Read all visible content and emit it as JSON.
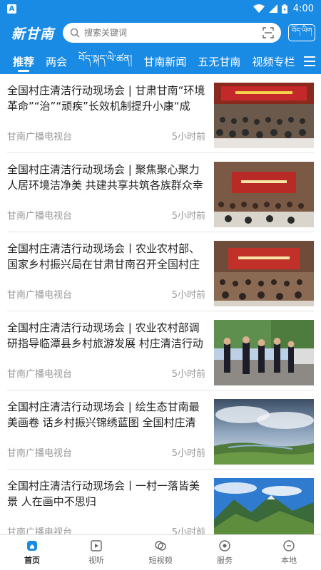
{
  "status_bar": {
    "time": "4:00",
    "app_badge": "A"
  },
  "header": {
    "logo": "新甘南",
    "search_placeholder": "搜索关键词",
    "lang_button": "བོད་ཡིག"
  },
  "tabs": [
    {
      "label": "推荐",
      "active": true
    },
    {
      "label": "两会"
    },
    {
      "label": "བོད་སྐད་ལེ་ཚན།"
    },
    {
      "label": "甘南新闻"
    },
    {
      "label": "五无甘南"
    },
    {
      "label": "视频专栏"
    }
  ],
  "feed": [
    {
      "title": "全国村庄清洁行动现场会 | 甘肃甘南“环境革命”“治”“顽疾”长效机制提升小康“成色”",
      "source": "甘南广播电视台",
      "time": "5小时前",
      "thumb": "meeting"
    },
    {
      "title": "全国村庄清洁行动现场会 | 聚焦聚心聚力人居环境洁净美 共建共享共筑各族群众幸福",
      "source": "甘南广播电视台",
      "time": "5小时前",
      "thumb": "meeting2"
    },
    {
      "title": "全国村庄清洁行动现场会丨农业农村部、国家乡村振兴局在甘肃甘南召开全国村庄",
      "source": "甘南广播电视台",
      "time": "5小时前",
      "thumb": "meeting3"
    },
    {
      "title": "全国村庄清洁行动现场会 | 农业农村部调研指导临潭县乡村旅游发展 村庄清洁行动 人",
      "source": "甘南广播电视台",
      "time": "5小时前",
      "thumb": "outdoor"
    },
    {
      "title": "全国村庄清洁行动现场会 | 绘生态甘南最美画卷 话乡村振兴锦绣蓝图  全国村庄清洁行",
      "source": "甘南广播电视台",
      "time": "5小时前",
      "thumb": "landscape"
    },
    {
      "title": "全国村庄清洁行动现场会丨一村一落皆美景 人在画中不思归",
      "source": "甘南广播电视台",
      "time": "5小时前",
      "thumb": "mountain"
    }
  ],
  "bottom_nav": [
    {
      "label": "首页",
      "icon": "home-icon",
      "active": true
    },
    {
      "label": "视听",
      "icon": "play-icon"
    },
    {
      "label": "短视频",
      "icon": "short-video-icon"
    },
    {
      "label": "服务",
      "icon": "service-icon"
    },
    {
      "label": "本地",
      "icon": "local-icon"
    }
  ],
  "colors": {
    "brand": "#1a8be5",
    "text": "#222222",
    "meta": "#999999"
  }
}
